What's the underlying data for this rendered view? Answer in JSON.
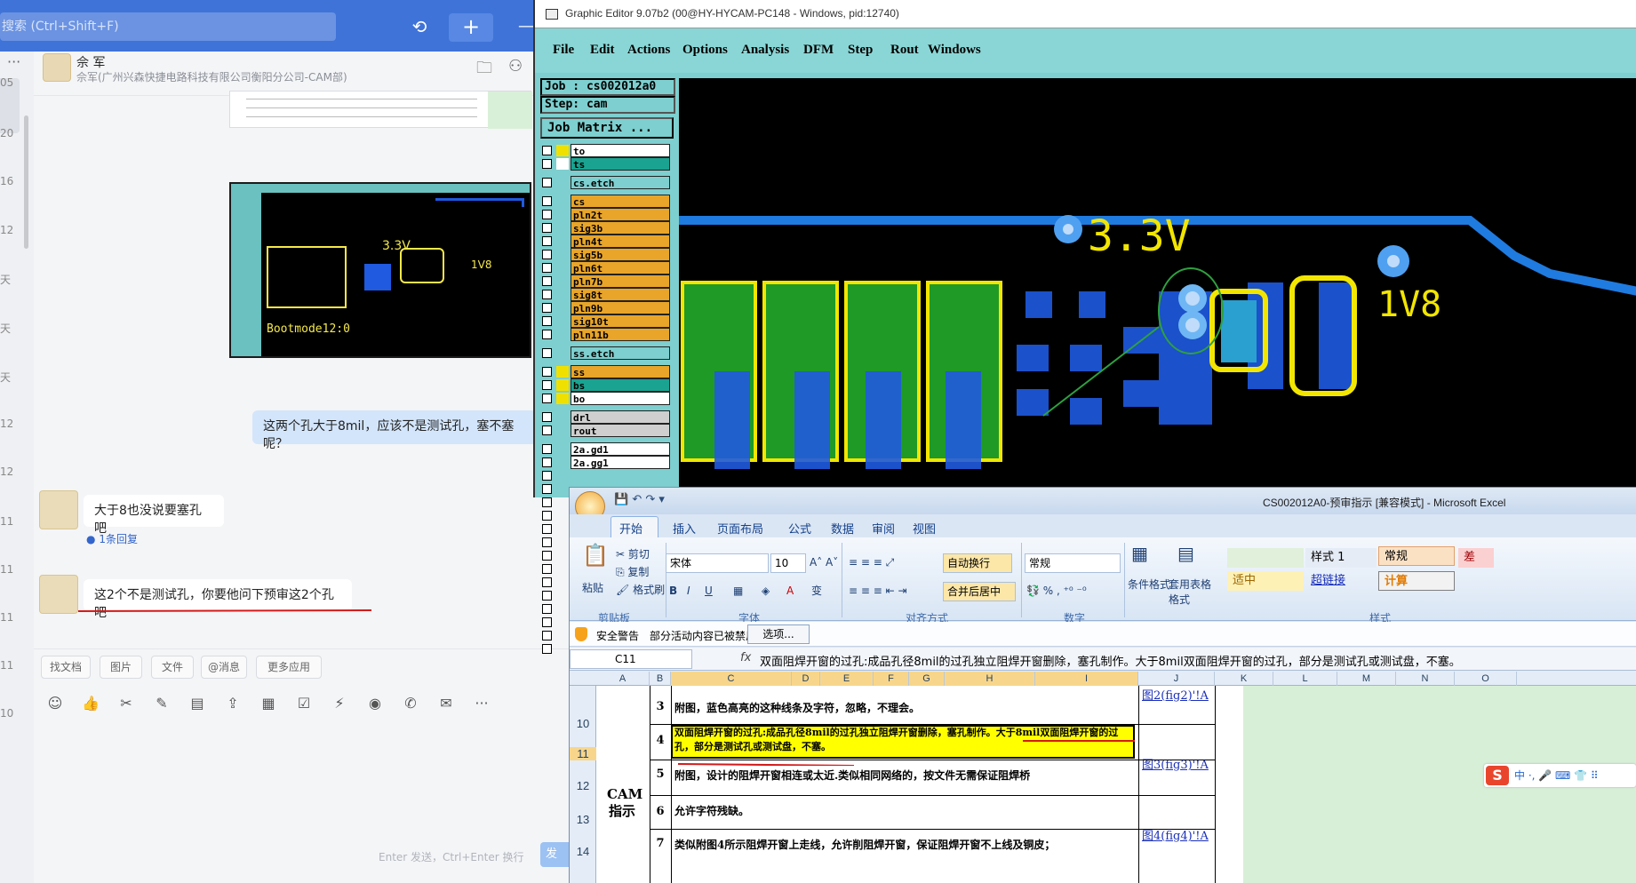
{
  "chat": {
    "search_placeholder": "搜索 (Ctrl+Shift+F)",
    "contact": {
      "name": "佘 军",
      "org": "佘军(广州兴森快捷电路科技有限公司衡阳分公司-CAM部)"
    },
    "conv_times": [
      "05",
      "20",
      "16",
      "12",
      "天",
      "天",
      "天",
      "12",
      "12",
      "11",
      "11",
      "11",
      "11",
      "10"
    ],
    "messages": [
      {
        "dir": "out",
        "text": "这两个孔大于8mil，应该不是测试孔，塞不塞呢？"
      },
      {
        "dir": "in",
        "text": "大于8也没说要塞孔吧",
        "reply": "1条回复"
      },
      {
        "dir": "in",
        "text": "这2个不是测试孔，你要他问下预审这2个孔吧"
      }
    ],
    "thumb2": {
      "label": "Bootmode12:0",
      "v33": "3.3V",
      "v18": "1V8"
    },
    "toolbar_pills": [
      "找文档",
      "图片",
      "文件",
      "@消息",
      "更多应用"
    ],
    "input_hint": "Enter 发送，Ctrl+Enter 换行",
    "send_label": "发"
  },
  "editor": {
    "title": "Graphic Editor 9.07b2 (00@HY-HYCAM-PC148 - Windows, pid:12740)",
    "menu": [
      "File",
      "Edit",
      "Actions",
      "Options",
      "Analysis",
      "DFM",
      "Step",
      "Rout",
      "Windows"
    ],
    "job": "Job : cs002012a0",
    "step": "Step: cam",
    "matrix_button": "Job Matrix ...",
    "layers": [
      {
        "name": "to",
        "color": "#ffffff",
        "swatch": "#f0e000"
      },
      {
        "name": "ts",
        "color": "#1aa390",
        "swatch": "#ffffff"
      },
      {
        "name": "cs.etch",
        "color": "#7ecfcf",
        "swatch": ""
      },
      {
        "name": "cs",
        "color": "#e8a52a",
        "swatch": ""
      },
      {
        "name": "pln2t",
        "color": "#e8a52a",
        "swatch": ""
      },
      {
        "name": "sig3b",
        "color": "#e8a52a",
        "swatch": ""
      },
      {
        "name": "pln4t",
        "color": "#e8a52a",
        "swatch": ""
      },
      {
        "name": "sig5b",
        "color": "#e8a52a",
        "swatch": ""
      },
      {
        "name": "pln6t",
        "color": "#e8a52a",
        "swatch": ""
      },
      {
        "name": "pln7b",
        "color": "#e8a52a",
        "swatch": ""
      },
      {
        "name": "sig8t",
        "color": "#e8a52a",
        "swatch": ""
      },
      {
        "name": "pln9b",
        "color": "#e8a52a",
        "swatch": ""
      },
      {
        "name": "sig10t",
        "color": "#e8a52a",
        "swatch": ""
      },
      {
        "name": "pln11b",
        "color": "#e8a52a",
        "swatch": ""
      },
      {
        "name": "ss.etch",
        "color": "#7ecfcf",
        "swatch": ""
      },
      {
        "name": "ss",
        "color": "#e8a52a",
        "swatch": "#f0e000"
      },
      {
        "name": "bs",
        "color": "#1aa390",
        "swatch": "#f0e000"
      },
      {
        "name": "bo",
        "color": "#ffffff",
        "swatch": "#f0e000"
      },
      {
        "name": "drl",
        "color": "#cfcfcf",
        "swatch": ""
      },
      {
        "name": "rout",
        "color": "#cfcfcf",
        "swatch": ""
      },
      {
        "name": "2a.gd1",
        "color": "#ffffff",
        "swatch": ""
      },
      {
        "name": "2a.gg1",
        "color": "#ffffff",
        "swatch": ""
      }
    ],
    "canvas": {
      "v33": "3.3V",
      "v18": "1V8"
    }
  },
  "excel": {
    "title": "CS002012A0-预审指示 [兼容模式] - Microsoft Excel",
    "tabs": [
      "开始",
      "插入",
      "页面布局",
      "公式",
      "数据",
      "审阅",
      "视图"
    ],
    "clipboard": {
      "paste": "粘贴",
      "cut": "剪切",
      "copy": "复制",
      "format_painter": "格式刷",
      "label": "剪贴板"
    },
    "font": {
      "name": "宋体",
      "size": "10",
      "label": "字体"
    },
    "align": {
      "wrap": "自动换行",
      "merge": "合并后居中",
      "label": "对齐方式"
    },
    "number": {
      "format": "常规",
      "label": "数字"
    },
    "styles": {
      "cond": "条件格式",
      "table": "套用表格格式",
      "style1": "样式 1",
      "normal": "常规",
      "bad": "差",
      "neutral": "适中",
      "hyperlink": "超链接",
      "calc": "计算",
      "label": "样式"
    },
    "warning": {
      "label": "安全警告",
      "text": "部分活动内容已被禁用。",
      "options": "选项..."
    },
    "namebox": "C11",
    "formula": "双面阻焊开窗的过孔:成品孔径8mil的过孔独立阻焊开窗删除，塞孔制作。大于8mil双面阻焊开窗的过孔，部分是测试孔或测试盘，不塞。",
    "columns": [
      "A",
      "B",
      "C",
      "D",
      "E",
      "F",
      "G",
      "H",
      "I",
      "J",
      "K",
      "L",
      "M",
      "N",
      "O"
    ],
    "rows": [
      {
        "num": "10",
        "idx": "3",
        "text": "附图，蓝色高亮的这种线条及字符，忽略，不理会。",
        "link": "图2(fig2)'!A"
      },
      {
        "num": "11",
        "idx": "4",
        "text": "双面阻焊开窗的过孔:成品孔径8mil的过孔独立阻焊开窗删除，塞孔制作。大于8mil双面阻焊开窗的过孔，部分是测试孔或测试盘，不塞。",
        "link": ""
      },
      {
        "num": "12",
        "idx": "5",
        "text": "附图，设计的阻焊开窗相连或太近.类似相同网络的，按文件无需保证阻焊桥",
        "link": "图3(fig3)'!A"
      },
      {
        "num": "13",
        "idx": "6",
        "text": "允许字符残缺。",
        "link": ""
      },
      {
        "num": "14",
        "idx": "7",
        "text": "类似附图4所示阻焊开窗上走线，允许削阻焊开窗，保证阻焊开窗不上线及铜皮；",
        "link": "图4(fig4)'!A"
      }
    ],
    "merged_label": "CAM指示",
    "ime": "中 ·, 🎤 ⌨ 👕 ⠿"
  }
}
